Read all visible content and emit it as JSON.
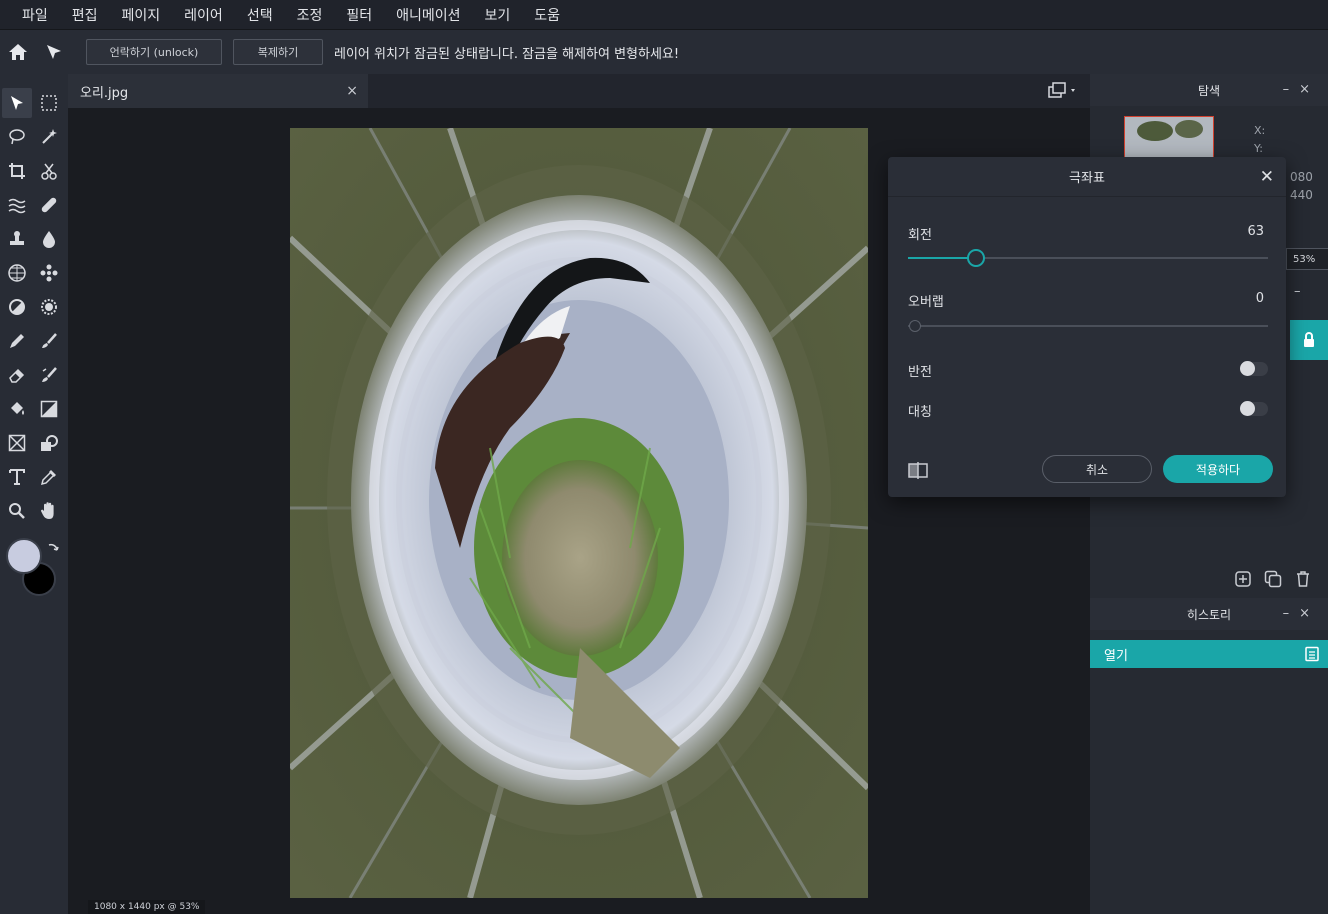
{
  "menu": [
    "파일",
    "편집",
    "페이지",
    "레이어",
    "선택",
    "조정",
    "필터",
    "애니메이션",
    "보기",
    "도움"
  ],
  "toolbar": {
    "unlock_label": "언락하기 (unlock)",
    "duplicate_label": "복제하기",
    "message": "레이어 위치가 잠금된 상태랍니다. 잠금을 해제하여 변형하세요!"
  },
  "document": {
    "tab_title": "오리.jpg",
    "close": "×",
    "status": "1080 x 1440 px @ 53%"
  },
  "navigator": {
    "title": "탐색",
    "x_label": "X:",
    "y_label": "Y:",
    "width_partial": "080",
    "height_partial": "440",
    "zoom_partial": "53%"
  },
  "history": {
    "title": "히스토리",
    "items": [
      "열기"
    ]
  },
  "dialog": {
    "title": "극좌표",
    "rotation_label": "회전",
    "rotation_value": "63",
    "rotation_fraction": 0.19,
    "overlap_label": "오버랩",
    "overlap_value": "0",
    "invert_label": "반전",
    "symmetry_label": "대칭",
    "cancel_label": "취소",
    "apply_label": "적용하다"
  },
  "colors": {
    "accent": "#1aa6a8",
    "foreground": "#c8cce0",
    "background": "#000000"
  }
}
